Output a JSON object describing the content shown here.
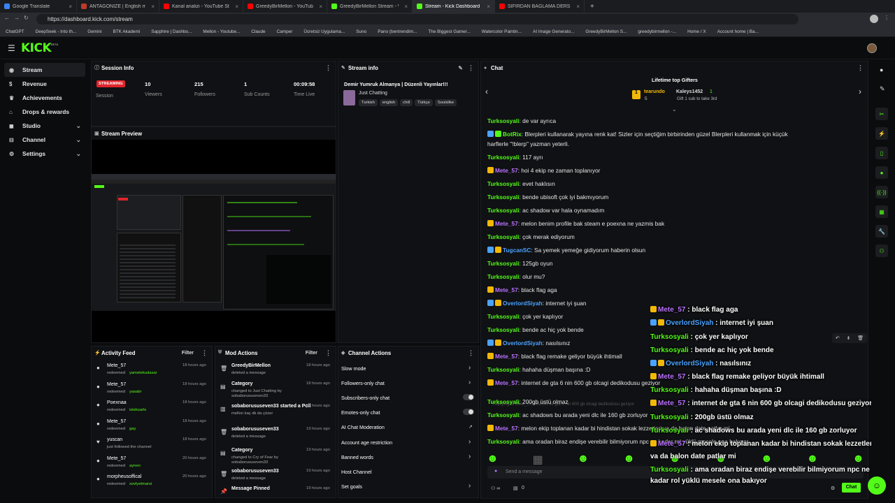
{
  "browser": {
    "tabs": [
      {
        "label": "Google Translate",
        "color": "#3b82f6"
      },
      {
        "label": "ANTAGONIZE | English meaning -",
        "color": "#c0392b"
      },
      {
        "label": "Kanal analizi - YouTube Studio",
        "color": "#ff0000"
      },
      {
        "label": "GreedyBirMellon - YouTube",
        "color": "#ff0000"
      },
      {
        "label": "GreedyBirMellon Stream - Watch...",
        "color": "#53fc18"
      },
      {
        "label": "Stream - Kick Dashboard",
        "color": "#53fc18"
      },
      {
        "label": "SIFIRDAN BAĞLAMA DERSİ 3 (EN...",
        "color": "#ff0000"
      }
    ],
    "url": "https://dashboard.kick.com/stream",
    "bookmarks": [
      "ChatGPT",
      "DeepSeek - Into th...",
      "Gemini",
      "BTK Akademi",
      "Sapphire | Dashbo...",
      "Mellon - Youtube...",
      "Claude",
      "Camper",
      "Ücretsiz Uygulama...",
      "Suno",
      "Pano (bentrendim...",
      "The Biggest Gamer...",
      "Watercolor Paintin...",
      "AI Image Generato...",
      "GreedyBirMellon S...",
      "greedybirmellon -...",
      "Home / X",
      "Account home | Ba..."
    ]
  },
  "app": {
    "logo": "KICK",
    "logo_sup": "BETA"
  },
  "sidebar": {
    "items": [
      {
        "label": "Stream",
        "icon": "broadcast-icon"
      },
      {
        "label": "Revenue",
        "icon": "revenue-icon"
      },
      {
        "label": "Achievements",
        "icon": "trophy-icon"
      },
      {
        "label": "Drops & rewards",
        "icon": "gift-icon"
      },
      {
        "label": "Studio",
        "icon": "studio-icon"
      },
      {
        "label": "Channel",
        "icon": "channel-icon"
      },
      {
        "label": "Settings",
        "icon": "gear-icon"
      }
    ]
  },
  "session": {
    "title": "Session Info",
    "status": "STREAMING",
    "status_label": "Session",
    "stats": [
      {
        "value": "10",
        "label": "Viewers"
      },
      {
        "value": "215",
        "label": "Followers"
      },
      {
        "value": "1",
        "label": "Sub Counts"
      },
      {
        "value": "00:09:58",
        "label": "Time Live"
      }
    ]
  },
  "preview": {
    "title": "Stream Preview"
  },
  "stream_info": {
    "title": "Stream info",
    "stream_title": "Demir Yumruk Almanya | Düzenli Yayınlar!!!",
    "category": "Just Chatting",
    "tags": [
      "Turkish",
      "english",
      "chill",
      "Türkçe",
      "Soulslike"
    ]
  },
  "activity": {
    "title": "Activity Feed",
    "filter": "Filter",
    "items": [
      {
        "user": "Mete_57",
        "time": "18 hours ago",
        "text": "redeemed",
        "reward": "yametekudasai"
      },
      {
        "user": "Mete_57",
        "time": "18 hours ago",
        "text": "redeemed",
        "reward": "yasabr"
      },
      {
        "user": "Poexnaa",
        "time": "18 hours ago",
        "text": "redeemed",
        "reward": "isteksarkı"
      },
      {
        "user": "Mete_57",
        "time": "18 hours ago",
        "text": "redeemed",
        "reward": "gay"
      },
      {
        "user": "yuscan",
        "time": "18 hours ago",
        "text": "just followed the channel",
        "reward": ""
      },
      {
        "user": "Mete_57",
        "time": "20 hours ago",
        "text": "redeemed",
        "reward": "aynen"
      },
      {
        "user": "morpheusoffical",
        "time": "20 hours ago",
        "text": "redeemed",
        "reward": "sovlyetmarsi"
      }
    ]
  },
  "mod": {
    "title": "Mod Actions",
    "filter": "Filter",
    "items": [
      {
        "title": "GreedyBirMellon",
        "sub": "deleted a message",
        "time": "18 hours ago"
      },
      {
        "title": "Category",
        "sub": "changed to Just Chatting by sobaborususeven33",
        "time": "18 hours ago"
      },
      {
        "title": "sobaborususeven33 started a Poll",
        "sub": "mellon kaç dk da çözer",
        "time": "18 hours ago"
      },
      {
        "title": "sobaborususeven33",
        "sub": "deleted a message",
        "time": "19 hours ago"
      },
      {
        "title": "Category",
        "sub": "changed to Cry of Fear by sobaborususeven33",
        "time": "19 hours ago"
      },
      {
        "title": "sobaborususeven33",
        "sub": "deleted a message",
        "time": "19 hours ago"
      },
      {
        "title": "Message Pinned",
        "sub": "",
        "time": "19 hours ago"
      }
    ]
  },
  "channel_actions": {
    "title": "Channel Actions",
    "items": [
      "Slow mode",
      "Followers-only chat",
      "Subscribers-only chat",
      "Emotes-only chat",
      "AI Chat Moderation",
      "Account age restriction",
      "Banned words",
      "Host Channel",
      "Set goals"
    ]
  },
  "chat": {
    "title": "Chat",
    "gifters_title": "Lifetime top Gifters",
    "gifter1": "tearundo",
    "gifter1_count": "5",
    "gifter2": "Kaleys1452",
    "gifter2_count": "1",
    "gift_note": "Gift 1 sub to take 3rd",
    "reply_note": "Replying to Mete_57: internet de gta 6 nin 600 gb olcagi dedikodusu geziyor",
    "input_placeholder": "Send a message",
    "send_label": "Chat",
    "footer_count": "0",
    "messages": [
      {
        "user": "Turksosyali",
        "cls": "tk",
        "text": "de var ayrıca"
      },
      {
        "user": "BotRix",
        "cls": "tk",
        "text": "Blerpleri kullanarak yayına renk kat! Sizler için seçtiğim birbirinden güzel Blerpleri kullanmak için küçük"
      },
      {
        "user": "",
        "cls": "",
        "text": "harflerle \"!blerp\" yazman yeterli."
      },
      {
        "user": "Turksosyali",
        "cls": "tk",
        "text": "117 ayrı"
      },
      {
        "user": "Mete_57",
        "cls": "pu",
        "text": "hoi 4 ekip ne zaman toplanıyor"
      },
      {
        "user": "Turksosyali",
        "cls": "tk",
        "text": "evet haklısın"
      },
      {
        "user": "Turksosyali",
        "cls": "tk",
        "text": "bende ubisoft çok iyi bakmıyorum"
      },
      {
        "user": "Turksosyali",
        "cls": "tk",
        "text": "ac shadow var hala oynamadım"
      },
      {
        "user": "Mete_57",
        "cls": "pu",
        "text": "melon benim profile bak steam e poexna ne yazmis bak"
      },
      {
        "user": "Turksosyali",
        "cls": "tk",
        "text": "çok merak ediyorum"
      },
      {
        "user": "TugcanSC",
        "cls": "bl",
        "text": "Sa yemek yemeğe gidiyorum haberin olsun"
      },
      {
        "user": "Turksosyali",
        "cls": "tk",
        "text": "125gb oyun"
      },
      {
        "user": "Turksosyali",
        "cls": "tk",
        "text": "olur mu?"
      },
      {
        "user": "Mete_57",
        "cls": "pu",
        "text": "black flag aga"
      },
      {
        "user": "OverlordSiyah",
        "cls": "bl",
        "text": "internet iyi şuan"
      },
      {
        "user": "Turksosyali",
        "cls": "tk",
        "text": "çok yer kaplıyor"
      },
      {
        "user": "Turksosyali",
        "cls": "tk",
        "text": "bende ac hiç yok bende"
      },
      {
        "user": "OverlordSiyah",
        "cls": "bl",
        "text": "nasılsınız"
      },
      {
        "user": "Mete_57",
        "cls": "pu",
        "text": "black flag remake geliyor büyük ihtimall"
      },
      {
        "user": "Turksosyali",
        "cls": "tk",
        "text": "hahaha düşman başına :D"
      },
      {
        "user": "Mete_57",
        "cls": "pu",
        "text": "internet de gta 6 nin 600 gb olcagi dedikodusu geziyor"
      },
      {
        "user": "Turksosyali",
        "cls": "tk",
        "text": "200gb üstü olmaz"
      },
      {
        "user": "Turksosyali",
        "cls": "tk",
        "text": "ac shadows bu arada yeni dlc ile 160 gb zorluyor"
      },
      {
        "user": "Mete_57",
        "cls": "pu",
        "text": "melon ekip toplanan kadar bi hindistan sokak lezzetleri va da balon date patlar mi"
      },
      {
        "user": "Turksosyali",
        "cls": "tk",
        "text": "ama oradan biraz endişe verebilir bilmiyorum npc ne kadar rol yüklü mesele ona bakıyor"
      }
    ]
  },
  "overlay": {
    "messages": [
      {
        "user": "Mete_57",
        "cls": "pu",
        "text": "black flag aga"
      },
      {
        "user": "OverlordSiyah",
        "cls": "bl",
        "text": "internet iyi şuan"
      },
      {
        "user": "Turksosyali",
        "cls": "tk",
        "text": "çok yer kaplıyor"
      },
      {
        "user": "Turksosyali",
        "cls": "tk",
        "text": "bende ac hiç yok bende"
      },
      {
        "user": "OverlordSiyah",
        "cls": "bl",
        "text": "nasılsınız"
      },
      {
        "user": "Mete_57",
        "cls": "pu",
        "text": "black flag remake geliyor büyük ihtimall"
      },
      {
        "user": "Turksosyali",
        "cls": "tk",
        "text": "hahaha düşman başına :D"
      },
      {
        "user": "Mete_57",
        "cls": "pu",
        "text": "internet de gta 6 nin 600 gb olcagi dedikodusu geziyor"
      },
      {
        "user": "Turksosyali",
        "cls": "tk",
        "text": "200gb üstü olmaz"
      },
      {
        "user": "Turksosyali",
        "cls": "tk",
        "text": "ac shadows bu arada yeni dlc ile 160 gb zorluyor"
      },
      {
        "user": "Mete_57",
        "cls": "pu",
        "text": "melon ekip toplanan kadar bi hindistan sokak lezzetleri"
      },
      {
        "user": "",
        "cls": "",
        "text": "va da balon date patlar mi"
      },
      {
        "user": "Turksosyali",
        "cls": "tk",
        "text": "ama oradan biraz endişe verebilir bilmiyorum npc ne"
      },
      {
        "user": "",
        "cls": "",
        "text": "kadar rol yüklü mesele ona bakıyor"
      }
    ]
  },
  "colors": {
    "accent": "#53fc18",
    "purple": "#b971ff",
    "blue": "#4aa3ff",
    "streaming": "#e0242b"
  }
}
